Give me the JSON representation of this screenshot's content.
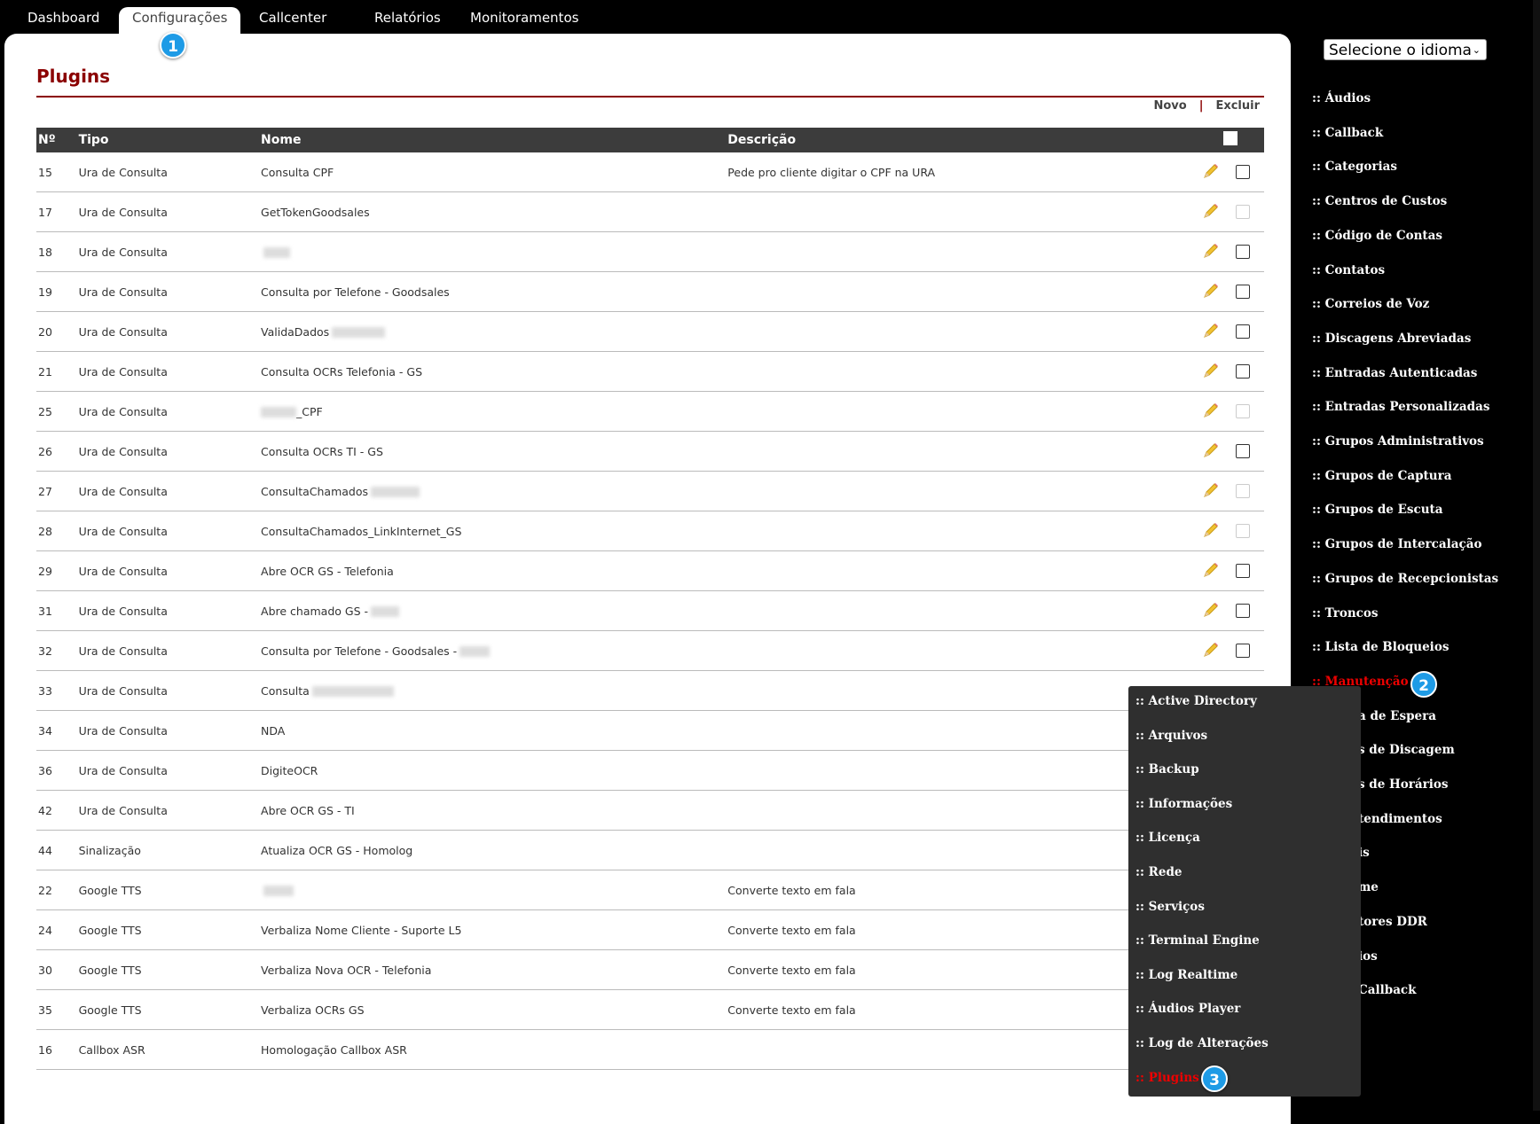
{
  "nav": {
    "tabs": [
      "Dashboard",
      "Configurações",
      "Callcenter",
      "Relatórios",
      "Monitoramentos"
    ],
    "active": "Configurações"
  },
  "page": {
    "title": "Plugins"
  },
  "actions": {
    "new_label": "Novo",
    "sep": "|",
    "delete_label": "Excluir"
  },
  "table": {
    "headers": [
      "Nº",
      "Tipo",
      "Nome",
      "Descrição"
    ],
    "rows": [
      {
        "num": "15",
        "tipo": "Ura de Consulta",
        "nome": "Consulta CPF",
        "desc": "Pede pro cliente digitar o CPF na URA",
        "dim": false
      },
      {
        "num": "17",
        "tipo": "Ura de Consulta",
        "nome": "GetTokenGoodsales",
        "desc": "",
        "dim": true
      },
      {
        "num": "18",
        "tipo": "Ura de Consulta",
        "nome": "",
        "desc": "",
        "dim": false,
        "blur": 30
      },
      {
        "num": "19",
        "tipo": "Ura de Consulta",
        "nome": "Consulta por Telefone - Goodsales",
        "desc": "",
        "dim": false
      },
      {
        "num": "20",
        "tipo": "Ura de Consulta",
        "nome": "ValidaDados",
        "desc": "",
        "dim": false,
        "blur": 60
      },
      {
        "num": "21",
        "tipo": "Ura de Consulta",
        "nome": "Consulta OCRs Telefonia - GS",
        "desc": "",
        "dim": false
      },
      {
        "num": "25",
        "tipo": "Ura de Consulta",
        "nome": "_CPF",
        "desc": "",
        "dim": true,
        "blurpre": 40
      },
      {
        "num": "26",
        "tipo": "Ura de Consulta",
        "nome": "Consulta OCRs TI - GS",
        "desc": "",
        "dim": false
      },
      {
        "num": "27",
        "tipo": "Ura de Consulta",
        "nome": "ConsultaChamados",
        "desc": "",
        "dim": true,
        "blur": 55
      },
      {
        "num": "28",
        "tipo": "Ura de Consulta",
        "nome": "ConsultaChamados_LinkInternet_GS",
        "desc": "",
        "dim": true
      },
      {
        "num": "29",
        "tipo": "Ura de Consulta",
        "nome": "Abre OCR GS - Telefonia",
        "desc": "",
        "dim": false
      },
      {
        "num": "31",
        "tipo": "Ura de Consulta",
        "nome": "Abre chamado GS -",
        "desc": "",
        "dim": false,
        "blur": 32
      },
      {
        "num": "32",
        "tipo": "Ura de Consulta",
        "nome": "Consulta por Telefone - Goodsales -",
        "desc": "",
        "dim": false,
        "blur": 34
      },
      {
        "num": "33",
        "tipo": "Ura de Consulta",
        "nome": "Consulta",
        "desc": "",
        "dim": false,
        "blur": 92,
        "hideactions": true
      },
      {
        "num": "34",
        "tipo": "Ura de Consulta",
        "nome": "NDA",
        "desc": "",
        "dim": false,
        "hideactions": true
      },
      {
        "num": "36",
        "tipo": "Ura de Consulta",
        "nome": "DigiteOCR",
        "desc": "",
        "dim": false,
        "hideactions": true
      },
      {
        "num": "42",
        "tipo": "Ura de Consulta",
        "nome": "Abre OCR GS - TI",
        "desc": "",
        "dim": false,
        "hideactions": true
      },
      {
        "num": "44",
        "tipo": "Sinalização",
        "nome": "Atualiza OCR GS - Homolog",
        "desc": "",
        "dim": false,
        "hideactions": true
      },
      {
        "num": "22",
        "tipo": "Google TTS",
        "nome": "",
        "desc": "Converte texto em fala",
        "dim": false,
        "blur": 34,
        "hideactions": true
      },
      {
        "num": "24",
        "tipo": "Google TTS",
        "nome": "Verbaliza Nome Cliente - Suporte L5",
        "desc": "Converte texto em fala",
        "dim": false,
        "hideactions": true
      },
      {
        "num": "30",
        "tipo": "Google TTS",
        "nome": "Verbaliza Nova OCR - Telefonia",
        "desc": "Converte texto em fala",
        "dim": false,
        "hideactions": true
      },
      {
        "num": "35",
        "tipo": "Google TTS",
        "nome": "Verbaliza OCRs GS",
        "desc": "Converte texto em fala",
        "dim": false,
        "hideactions": true
      },
      {
        "num": "16",
        "tipo": "Callbox ASR",
        "nome": "Homologação Callbox ASR",
        "desc": "",
        "dim": false,
        "hideactions": true
      }
    ]
  },
  "sidebar": {
    "language_label": "Selecione o idioma",
    "items": [
      ":: Áudios",
      ":: Callback",
      ":: Categorias",
      ":: Centros de Custos",
      ":: Código de Contas",
      ":: Contatos",
      ":: Correios de Voz",
      ":: Discagens Abreviadas",
      ":: Entradas Autenticadas",
      ":: Entradas Personalizadas",
      ":: Grupos Administrativos",
      ":: Grupos de Captura",
      ":: Grupos de Escuta",
      ":: Grupos de Intercalação",
      ":: Grupos de Recepcionistas",
      ":: Troncos",
      ":: Lista de Bloqueios",
      ":: Manutenção",
      "a de Espera",
      "s de Discagem",
      "s de Horários",
      "tendimentos",
      "is",
      "me",
      "tores DDR",
      "ios",
      "Callback"
    ],
    "active_index": 17
  },
  "submenu": {
    "items": [
      ":: Active Directory",
      ":: Arquivos",
      ":: Backup",
      ":: Informações",
      ":: Licença",
      ":: Rede",
      ":: Serviços",
      ":: Terminal Engine",
      ":: Log Realtime",
      ":: Áudios Player",
      ":: Log de Alterações",
      ":: Plugins"
    ],
    "active_index": 11
  },
  "badges": [
    "1",
    "2",
    "3"
  ],
  "colors": {
    "title": "#8b0000",
    "active_menu": "#e00000",
    "badge": "#1e9be6",
    "header_bg": "#3c3c3c"
  }
}
